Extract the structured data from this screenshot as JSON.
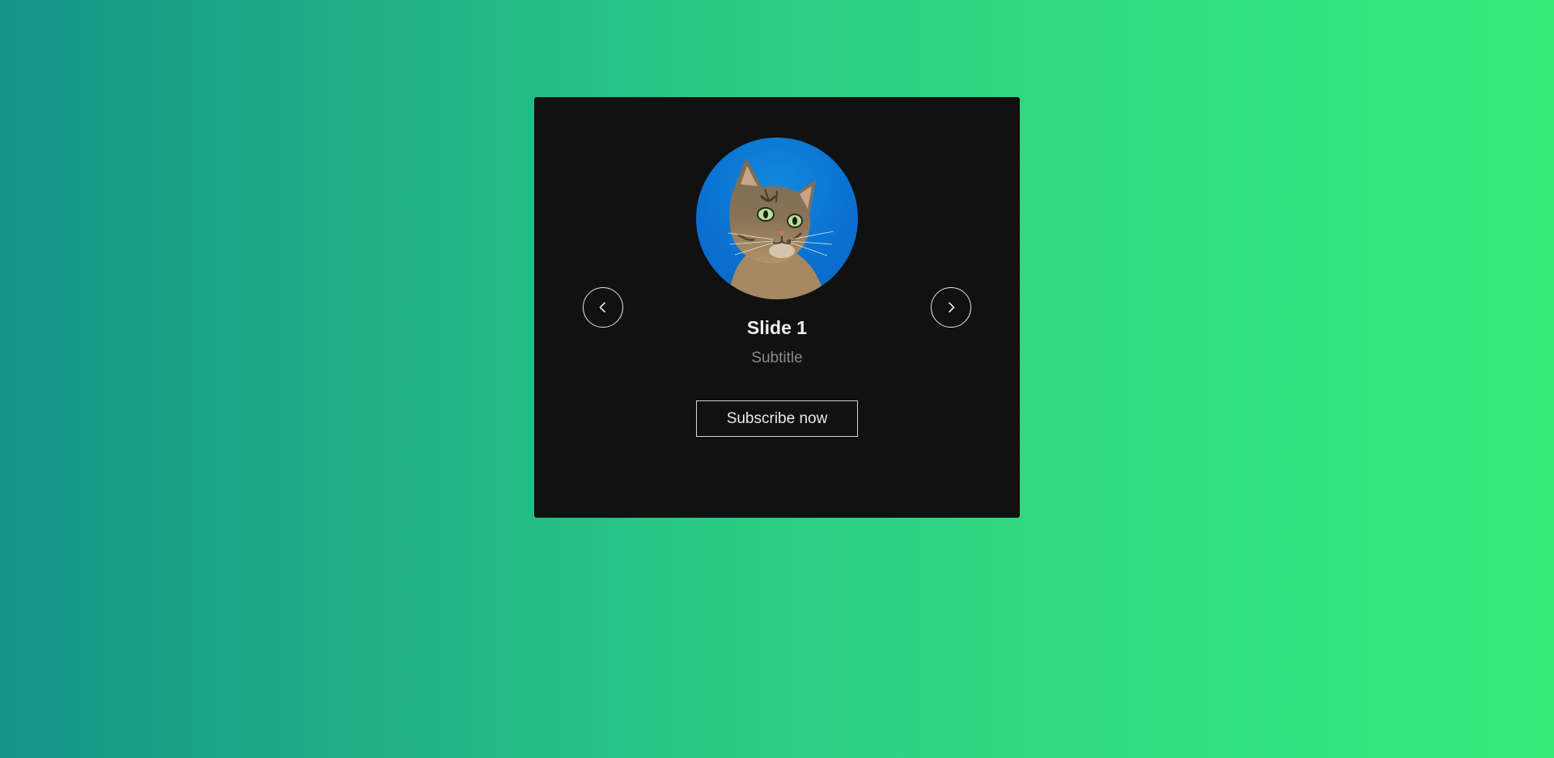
{
  "slide": {
    "title": "Slide 1",
    "subtitle": "Subtitle",
    "subscribe_label": "Subscribe now",
    "image_alt": "cat-photo"
  },
  "navigation": {
    "prev_icon": "chevron-left-icon",
    "next_icon": "chevron-right-icon"
  },
  "colors": {
    "card_background": "#111111",
    "gradient_start": "#149488",
    "gradient_end": "#38ec7c",
    "avatar_sky": "#0a6fd0"
  }
}
